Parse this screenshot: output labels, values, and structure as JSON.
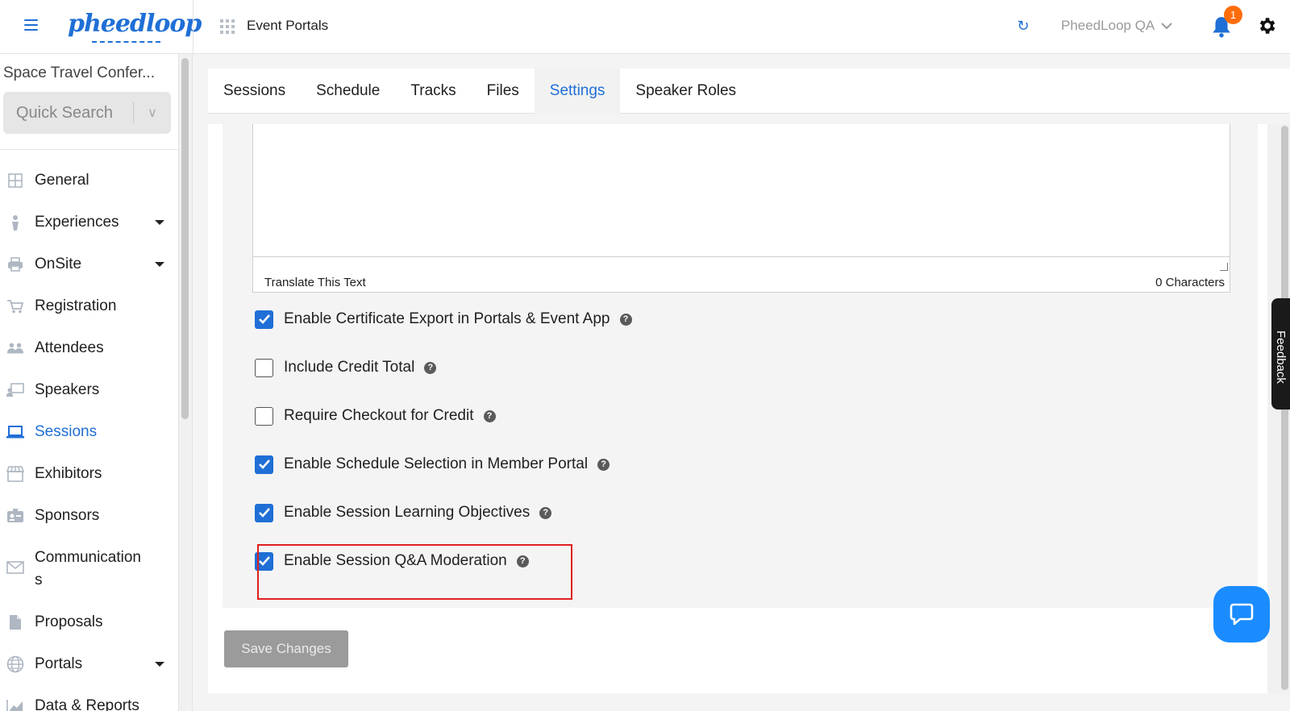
{
  "header": {
    "logo_text": "pheedloop",
    "title": "Event Portals",
    "user_label": "PheedLoop QA",
    "notification_count": "1"
  },
  "sidebar": {
    "event_name": "Space Travel Confer...",
    "quick_search_placeholder": "Quick Search",
    "items": [
      {
        "label": "General",
        "icon": "grid-icon",
        "has_caret": false
      },
      {
        "label": "Experiences",
        "icon": "person-icon",
        "has_caret": true
      },
      {
        "label": "OnSite",
        "icon": "printer-icon",
        "has_caret": true
      },
      {
        "label": "Registration",
        "icon": "cart-icon",
        "has_caret": false
      },
      {
        "label": "Attendees",
        "icon": "people-icon",
        "has_caret": false
      },
      {
        "label": "Speakers",
        "icon": "presenter-icon",
        "has_caret": false
      },
      {
        "label": "Sessions",
        "icon": "laptop-icon",
        "has_caret": false,
        "active": true
      },
      {
        "label": "Exhibitors",
        "icon": "storefront-icon",
        "has_caret": false
      },
      {
        "label": "Sponsors",
        "icon": "badge-icon",
        "has_caret": false
      },
      {
        "label": "Communication\ns",
        "icon": "mail-icon",
        "has_caret": false
      },
      {
        "label": "Proposals",
        "icon": "document-icon",
        "has_caret": false
      },
      {
        "label": "Portals",
        "icon": "globe-icon",
        "has_caret": true
      },
      {
        "label": "Data & Reports",
        "icon": "chart-icon",
        "has_caret": false
      }
    ]
  },
  "tabs": [
    {
      "label": "Sessions",
      "active": false
    },
    {
      "label": "Schedule",
      "active": false
    },
    {
      "label": "Tracks",
      "active": false
    },
    {
      "label": "Files",
      "active": false
    },
    {
      "label": "Settings",
      "active": true
    },
    {
      "label": "Speaker Roles",
      "active": false
    }
  ],
  "editor": {
    "translate_link": "Translate This Text",
    "char_count": "0 Characters"
  },
  "options": [
    {
      "label": "Enable Certificate Export in Portals & Event App",
      "checked": true
    },
    {
      "label": "Include Credit Total",
      "checked": false
    },
    {
      "label": "Require Checkout for Credit",
      "checked": false
    },
    {
      "label": "Enable Schedule Selection in Member Portal",
      "checked": true
    },
    {
      "label": "Enable Session Learning Objectives",
      "checked": true
    },
    {
      "label": "Enable Session Q&A Moderation",
      "checked": true
    }
  ],
  "save_button": "Save Changes",
  "feedback_label": "Feedback",
  "colors": {
    "accent": "#1f6fd6",
    "badge": "#ff6d0a",
    "highlight": "#e02020",
    "chat": "#1a8cff"
  }
}
